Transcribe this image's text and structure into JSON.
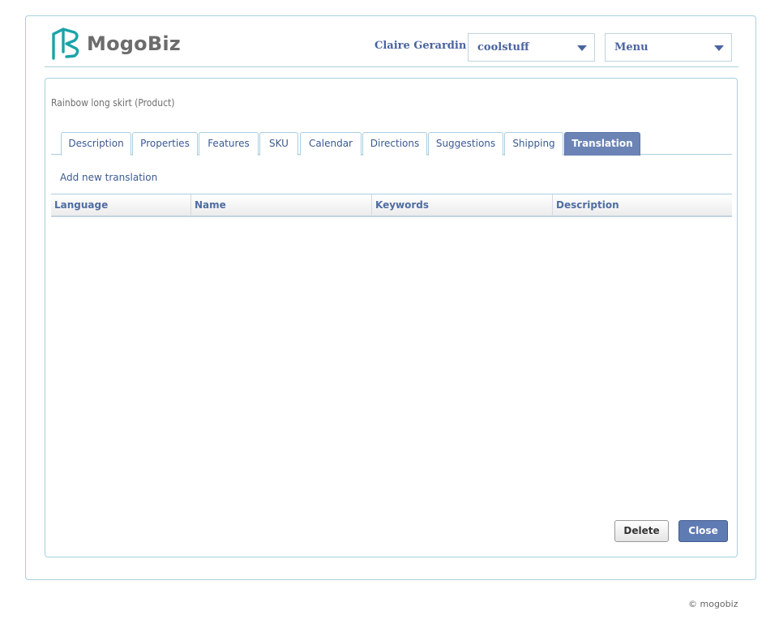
{
  "app": {
    "logo_text": "MogoBiz",
    "brand_color": "#1aa3a8"
  },
  "header": {
    "user_name": "Claire Gerardin",
    "store_select": {
      "value": "coolstuff"
    },
    "menu_select": {
      "value": "Menu"
    }
  },
  "page": {
    "breadcrumb": "Rainbow long skirt (Product)",
    "tabs": [
      {
        "label": "Description",
        "active": false
      },
      {
        "label": "Properties",
        "active": false
      },
      {
        "label": "Features",
        "active": false
      },
      {
        "label": "SKU",
        "active": false
      },
      {
        "label": "Calendar",
        "active": false
      },
      {
        "label": "Directions",
        "active": false
      },
      {
        "label": "Suggestions",
        "active": false
      },
      {
        "label": "Shipping",
        "active": false
      },
      {
        "label": "Translation",
        "active": true
      }
    ],
    "add_link": "Add new translation",
    "table": {
      "columns": [
        "Language",
        "Name",
        "Keywords",
        "Description"
      ],
      "rows": []
    },
    "buttons": {
      "delete": "Delete",
      "close": "Close"
    }
  },
  "footer": {
    "copyright": "© mogobiz"
  },
  "colors": {
    "accent": "#4a64a0",
    "active_tab": "#6b84b5",
    "border": "#a9cfdf"
  }
}
